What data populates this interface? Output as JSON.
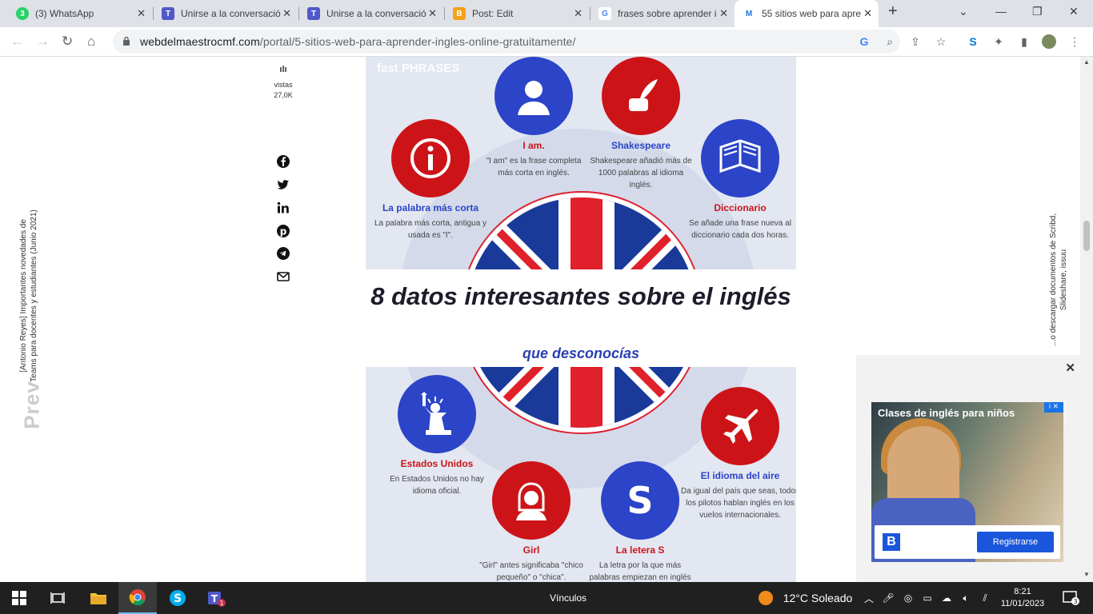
{
  "tabs": [
    {
      "title": "(3) WhatsApp",
      "fav": "3",
      "color": "#25d366"
    },
    {
      "title": "Unirse a la conversació",
      "fav": "T",
      "color": "#5059c9"
    },
    {
      "title": "Unirse a la conversació",
      "fav": "T",
      "color": "#5059c9"
    },
    {
      "title": "Post: Edit",
      "fav": "B",
      "color": "#f4a218"
    },
    {
      "title": "frases sobre aprender i",
      "fav": "G",
      "color": "#4285f4"
    },
    {
      "title": "55 sitios web para apre",
      "fav": "M",
      "color": "#1a73e8"
    }
  ],
  "url": {
    "domain": "webdelmaestrocmf.com",
    "path": "/portal/5-sitios-web-para-aprender-ingles-online-gratuitamente/"
  },
  "stats": {
    "label": "vistas",
    "count": "27,0K"
  },
  "left_related": "[Antonio Reyes] Importantes novedades de Teams para docentes y estudiantes (Junio 2021)",
  "prev_label": "Prev",
  "right_related": "...o descargar documentos de Scribd, Slideshare, issuu",
  "infographic": {
    "brand": "fast PHRASES",
    "title": "8 datos interesantes sobre el inglés",
    "subtitle": "que desconocías",
    "facts": [
      {
        "title": "I am.",
        "desc": "\"I am\" es la frase completa más corta en inglés."
      },
      {
        "title": "Shakespeare",
        "desc": "Shakespeare añadió más de 1000 palabras al idioma inglés."
      },
      {
        "title": "La palabra más corta",
        "desc": "La palabra más corta, antigua y usada es \"I\"."
      },
      {
        "title": "Diccionario",
        "desc": "Se añade una frase nueva al diccionario cada dos horas."
      },
      {
        "title": "Estados Unidos",
        "desc": "En Estados Unidos no hay idioma oficial."
      },
      {
        "title": "El idioma del aire",
        "desc": "Da igual del país que seas, todos los pilotos hablan inglés en los vuelos internacionales."
      },
      {
        "title": "Girl",
        "desc": "\"Girl\" antes significaba \"chico pequeño\" o \"chica\"."
      },
      {
        "title": "La letera S",
        "desc": "La letra por la que más palabras empiezan en inglés"
      }
    ]
  },
  "ad": {
    "title": "Clases de inglés para niños",
    "cta": "Registrarse",
    "brand_letter": "B",
    "info": "i"
  },
  "taskbar": {
    "links": "Vínculos",
    "weather": "12°C  Soleado",
    "time": "8:21",
    "date": "11/01/2023",
    "notif": "3"
  }
}
